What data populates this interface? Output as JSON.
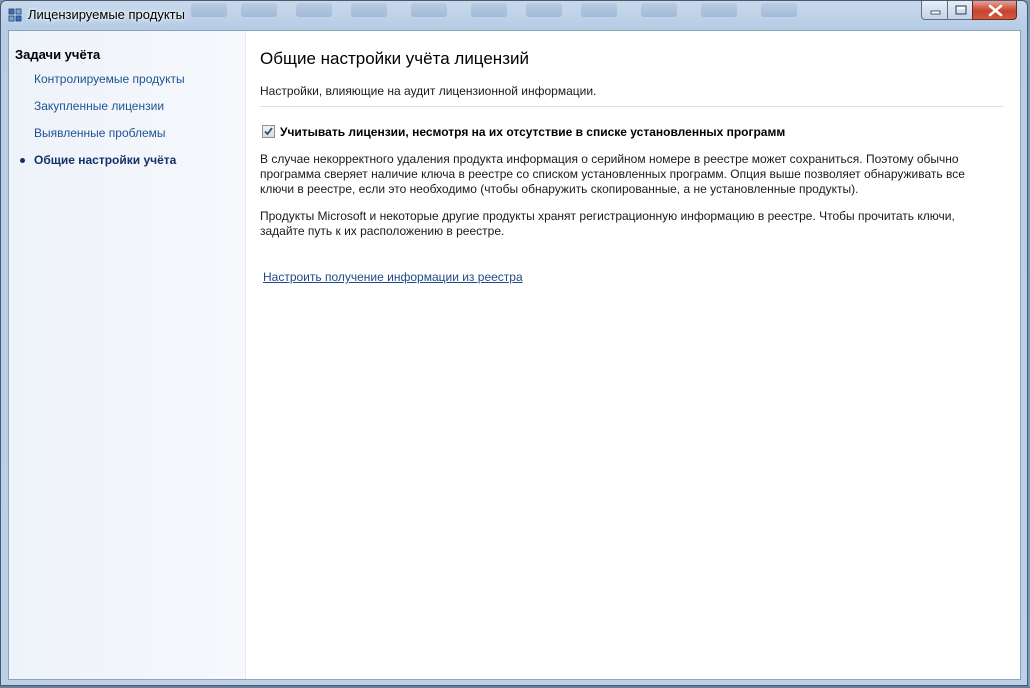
{
  "window": {
    "title": "Лицензируемые продукты"
  },
  "sidebar": {
    "heading": "Задачи учёта",
    "items": [
      {
        "label": "Контролируемые продукты",
        "active": false
      },
      {
        "label": "Закупленные лицензии",
        "active": false
      },
      {
        "label": "Выявленные проблемы",
        "active": false
      },
      {
        "label": "Общие настройки учёта",
        "active": true
      }
    ]
  },
  "main": {
    "title": "Общие настройки учёта лицензий",
    "subtitle": "Настройки, влияющие на аудит лицензионной информации.",
    "checkbox": {
      "label": "Учитывать лицензии, несмотря на их отсутствие в списке установленных программ",
      "checked": true
    },
    "paragraph1": "В случае некорректного удаления продукта информация о серийном номере в реестре может сохраниться. Поэтому обычно программа сверяет наличие ключа в реестре со списком установленных программ. Опция выше позволяет обнаруживать все ключи в реестре, если это необходимо (чтобы обнаружить скопированные, а не установленные продукты).",
    "paragraph2": "Продукты Microsoft и некоторые другие продукты хранят регистрационную информацию в реестре. Чтобы прочитать ключи, задайте путь к их расположению в реестре.",
    "link": "Настроить получение информации из реестра"
  },
  "colors": {
    "nav_link": "#1e5393",
    "nav_active": "#15306b",
    "link": "#1e4a86",
    "close_button": "#c7432e"
  },
  "icons": {
    "app": "license-app-icon",
    "minimize": "minimize-icon",
    "maximize": "maximize-icon",
    "close": "close-icon",
    "check": "checkmark-icon"
  }
}
